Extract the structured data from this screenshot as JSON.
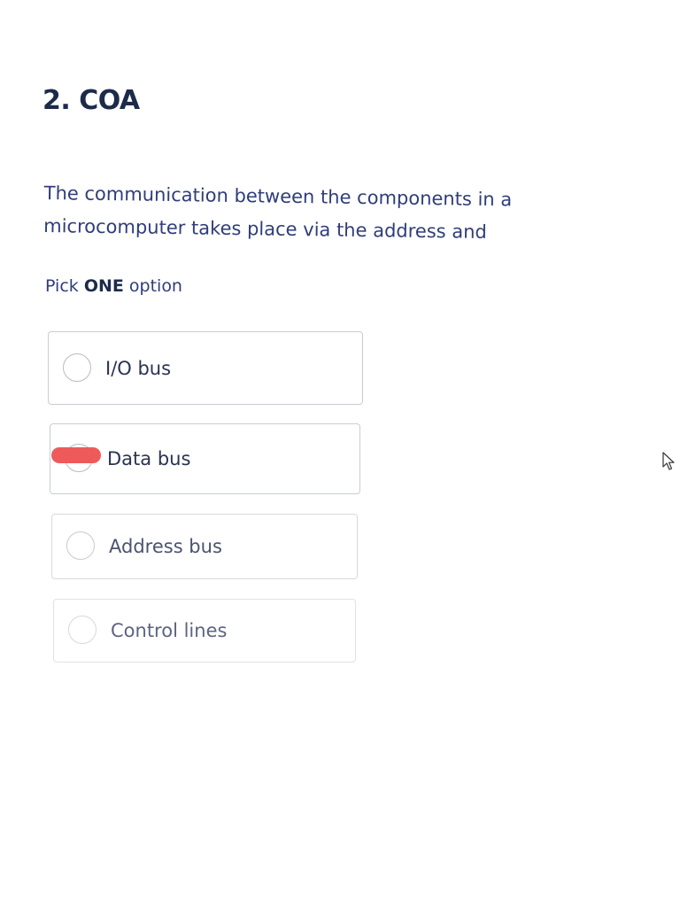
{
  "question": {
    "title": "2. COA",
    "text": "The communication between the components in a microcomputer takes place via the address and",
    "instruction_prefix": "Pick ",
    "instruction_bold": "ONE",
    "instruction_suffix": " option"
  },
  "options": [
    {
      "label": "I/O bus",
      "selected": false
    },
    {
      "label": "Data bus",
      "selected": false
    },
    {
      "label": "Address bus",
      "selected": false
    },
    {
      "label": "Control lines",
      "selected": false
    }
  ],
  "colors": {
    "title": "#1d2b4a",
    "text": "#2f3d7a",
    "border": "#c9ccd6",
    "highlight": "#ee5a5a"
  },
  "icons": {
    "cursor": "mouse-pointer-icon",
    "radio": "radio-circle-icon"
  }
}
